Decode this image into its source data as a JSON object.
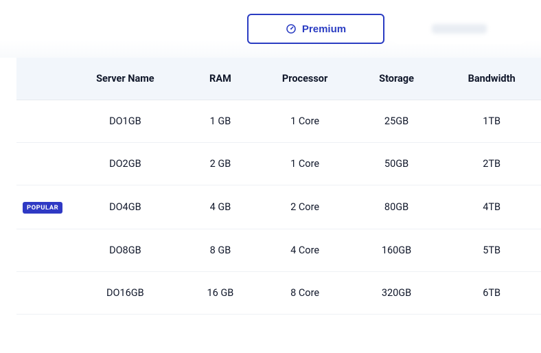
{
  "tabs": {
    "premium_label": "Premium"
  },
  "table": {
    "headers": {
      "server_name": "Server Name",
      "ram": "RAM",
      "processor": "Processor",
      "storage": "Storage",
      "bandwidth": "Bandwidth"
    },
    "badge_label": "POPULAR",
    "rows": [
      {
        "name": "DO1GB",
        "ram": "1 GB",
        "processor": "1 Core",
        "storage": "25GB",
        "bandwidth": "1TB",
        "popular": false
      },
      {
        "name": "DO2GB",
        "ram": "2 GB",
        "processor": "1 Core",
        "storage": "50GB",
        "bandwidth": "2TB",
        "popular": false
      },
      {
        "name": "DO4GB",
        "ram": "4 GB",
        "processor": "2 Core",
        "storage": "80GB",
        "bandwidth": "4TB",
        "popular": true
      },
      {
        "name": "DO8GB",
        "ram": "8 GB",
        "processor": "4 Core",
        "storage": "160GB",
        "bandwidth": "5TB",
        "popular": false
      },
      {
        "name": "DO16GB",
        "ram": "16 GB",
        "processor": "8 Core",
        "storage": "320GB",
        "bandwidth": "6TB",
        "popular": false
      }
    ]
  }
}
